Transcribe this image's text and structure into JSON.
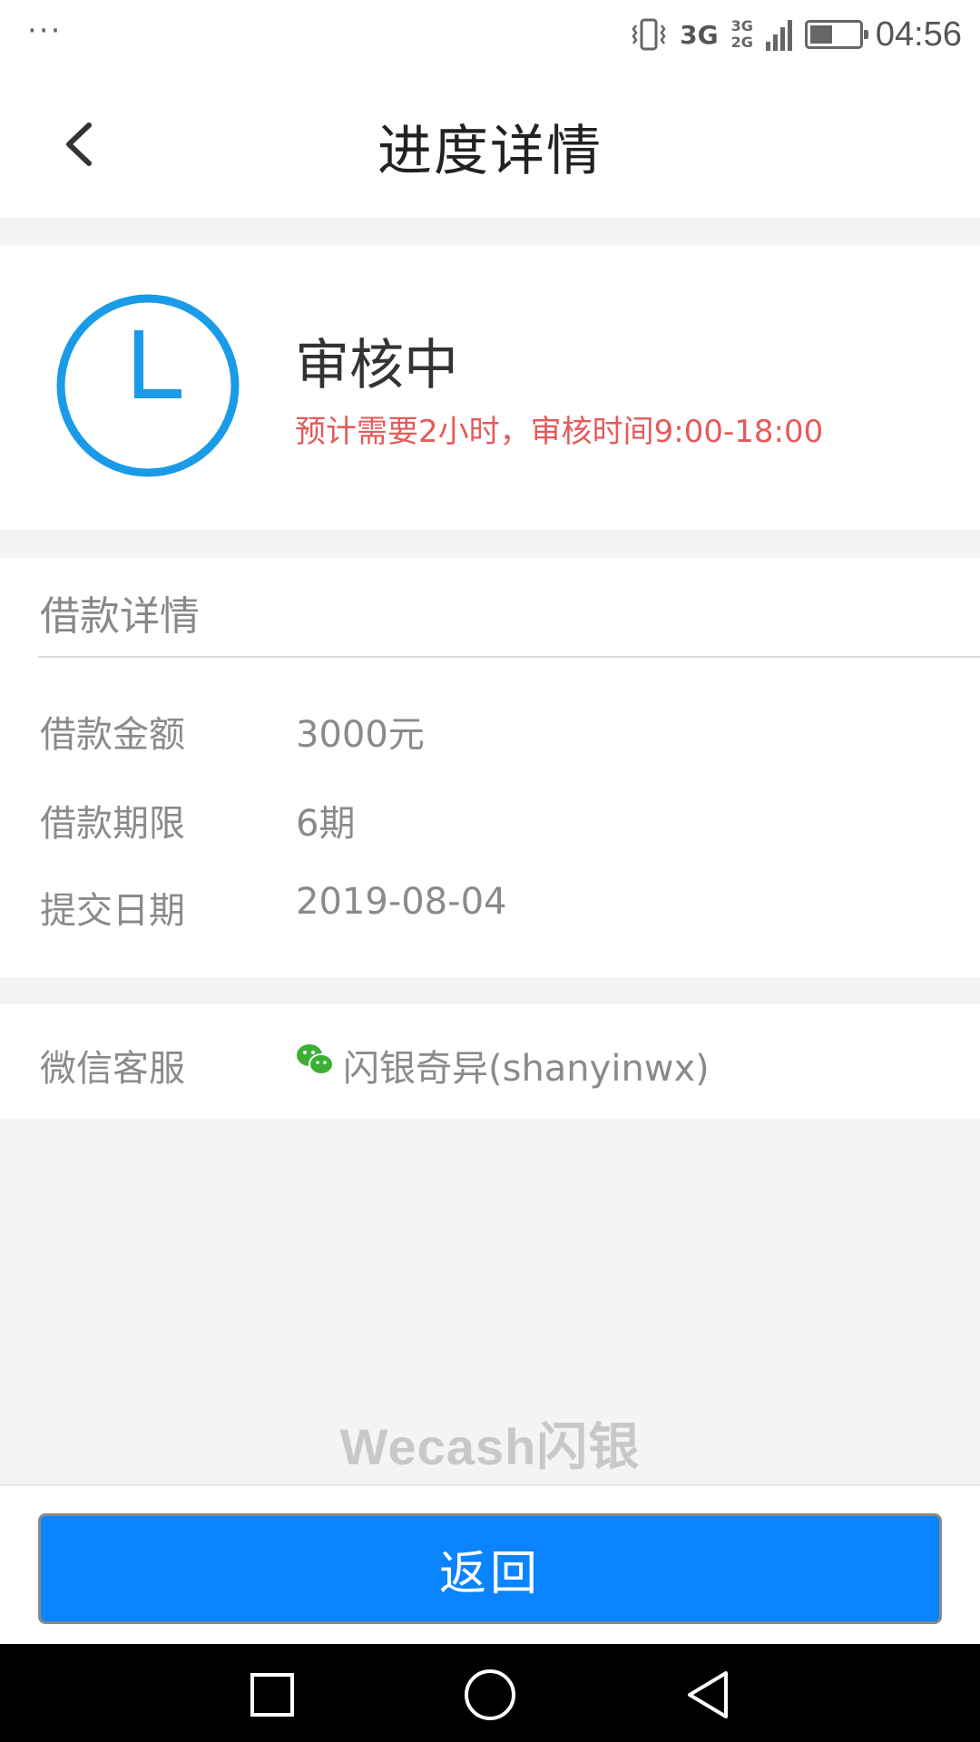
{
  "status_bar": {
    "menu_dots": "···",
    "network_primary": "3G",
    "network_secondary_top": "3G",
    "network_secondary_bottom": "2G",
    "time": "04:56"
  },
  "header": {
    "title": "进度详情"
  },
  "status_card": {
    "title": "审核中",
    "note": "预计需要2小时，审核时间9:00-18:00",
    "icon": "clock-icon",
    "accent_color": "#1a9be8",
    "note_color": "#e55a5a"
  },
  "loan_details": {
    "heading": "借款详情",
    "rows": [
      {
        "label": "借款金额",
        "value": "3000元"
      },
      {
        "label": "借款期限",
        "value": "6期"
      },
      {
        "label": "提交日期",
        "value": "2019-08-04"
      }
    ]
  },
  "wechat_service": {
    "label": "微信客服",
    "icon": "wechat-icon",
    "value": "闪银奇异(shanyinwx)"
  },
  "watermark": "Wecash闪银",
  "return_button": {
    "label": "返回",
    "color": "#0a84ff"
  }
}
